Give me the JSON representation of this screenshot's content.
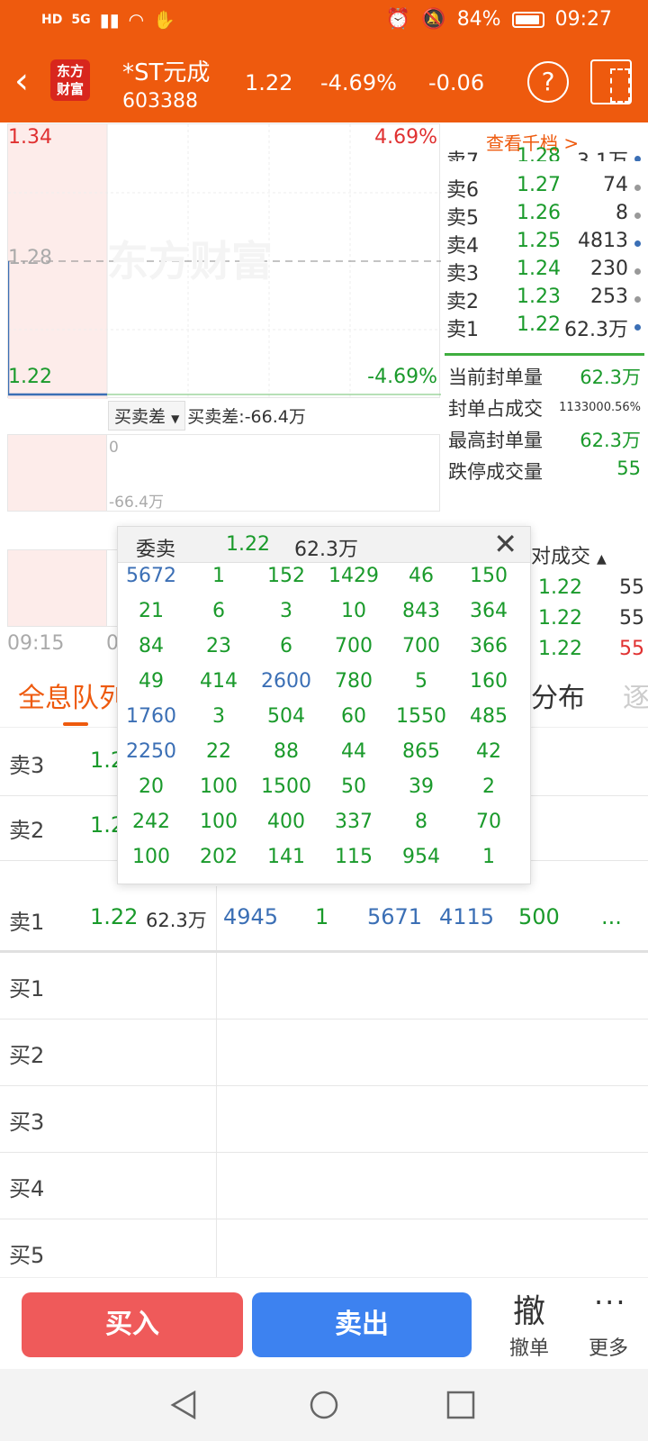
{
  "status": {
    "network": "5G",
    "hd": "HD",
    "battery": "84%",
    "time": "09:27"
  },
  "header": {
    "back": "‹",
    "logo_line1": "东方",
    "logo_line2": "财富",
    "name": "*ST元成",
    "code": "603388",
    "price": "1.22",
    "change_pct": "-4.69%",
    "change": "-0.06",
    "help": "?"
  },
  "chart": {
    "price_high": "1.34",
    "pct_high": "4.69%",
    "price_mid": "1.28",
    "price_low": "1.22",
    "pct_low": "-4.69%",
    "watermark": "东方财富",
    "diff_select": "买卖差",
    "diff_value": "买卖差:-66.4万",
    "sub_zero": "0",
    "sub_min": "-66.4万",
    "time_start": "09:15",
    "time_partial": "0"
  },
  "book": {
    "title": "查看千档 >",
    "asks": [
      {
        "label": "卖7",
        "price": "1.28",
        "vol": "3.1万",
        "dot": "#3b6fb5"
      },
      {
        "label": "卖6",
        "price": "1.27",
        "vol": "74",
        "dot": "#999999"
      },
      {
        "label": "卖5",
        "price": "1.26",
        "vol": "8",
        "dot": "#999999"
      },
      {
        "label": "卖4",
        "price": "1.25",
        "vol": "4813",
        "dot": "#3b6fb5"
      },
      {
        "label": "卖3",
        "price": "1.24",
        "vol": "230",
        "dot": "#999999"
      },
      {
        "label": "卖2",
        "price": "1.23",
        "vol": "253",
        "dot": "#999999"
      },
      {
        "label": "卖1",
        "price": "1.22",
        "vol": "62.3万",
        "dot": "#3b6fb5"
      }
    ],
    "stats": [
      {
        "label": "当前封单量",
        "value": "62.3万"
      },
      {
        "label": "封单占成交",
        "value": "1133000.56%"
      },
      {
        "label": "最高封单量",
        "value": "62.3万"
      },
      {
        "label": "跌停成交量",
        "value": "55"
      }
    ],
    "trades_title": "对成交",
    "trades": [
      {
        "price": "1.22",
        "vol": "55"
      },
      {
        "price": "1.22",
        "vol": "55"
      },
      {
        "price": "1.22",
        "vol": "55"
      }
    ]
  },
  "tabs": {
    "active": "全息队列",
    "right": "分布",
    "far_right": "逐"
  },
  "queue": {
    "rows": [
      {
        "label": "卖3",
        "price": "1.2"
      },
      {
        "label": "卖2",
        "price": "1.2"
      },
      {
        "label": "卖1",
        "price": "1.22",
        "vol": "62.3万",
        "values": [
          "4945",
          "1",
          "5671",
          "4115",
          "500",
          "..."
        ]
      },
      {
        "label": "买1"
      },
      {
        "label": "买2"
      },
      {
        "label": "买3"
      },
      {
        "label": "买4"
      },
      {
        "label": "买5"
      }
    ]
  },
  "popup": {
    "title": "委卖",
    "price": "1.22",
    "vol": "62.3万",
    "close": "✕",
    "grid": [
      [
        "5672",
        "1",
        "152",
        "1429",
        "46",
        "150"
      ],
      [
        "21",
        "6",
        "3",
        "10",
        "843",
        "364"
      ],
      [
        "84",
        "23",
        "6",
        "700",
        "700",
        "366"
      ],
      [
        "49",
        "414",
        "2600",
        "780",
        "5",
        "160"
      ],
      [
        "1760",
        "3",
        "504",
        "60",
        "1550",
        "485"
      ],
      [
        "2250",
        "22",
        "88",
        "44",
        "865",
        "42"
      ],
      [
        "20",
        "100",
        "1500",
        "50",
        "39",
        "2"
      ],
      [
        "242",
        "100",
        "400",
        "337",
        "8",
        "70"
      ],
      [
        "100",
        "202",
        "141",
        "115",
        "954",
        "1"
      ]
    ],
    "blue_values": [
      "5672",
      "2600",
      "1760",
      "2250"
    ]
  },
  "bottom": {
    "buy": "买入",
    "sell": "卖出",
    "cancel_icon": "撤",
    "cancel": "撤单",
    "more_icon": "···",
    "more": "更多"
  },
  "colors": {
    "brand": "#ee5a0e",
    "up": "#e03131",
    "down": "#1a9a2b",
    "blue": "#3b6fb5",
    "buy_btn": "#ef5a5a",
    "sell_btn": "#3d82f0"
  }
}
